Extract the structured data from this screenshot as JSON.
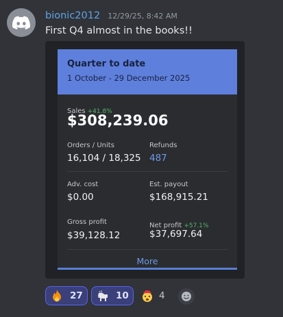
{
  "message": {
    "username": "bionic2012",
    "timestamp": "12/29/25, 8:42 AM",
    "text": "First Q4 almost in the books!!",
    "avatar_icon": "discord-logo-icon"
  },
  "embed": {
    "title": "Quarter to date",
    "date_range": "1 October - 29 December 2025",
    "sales": {
      "label": "Sales",
      "change": "+41.8%",
      "value": "$308,239.06"
    },
    "orders_units": {
      "label": "Orders / Units",
      "value": "16,104 / 18,325"
    },
    "refunds": {
      "label": "Refunds",
      "value": "487"
    },
    "adv_cost": {
      "label": "Adv. cost",
      "value": "$0.00"
    },
    "est_payout": {
      "label": "Est. payout",
      "value": "$168,915.21"
    },
    "gross_profit": {
      "label": "Gross profit",
      "value": "$39,128.12"
    },
    "net_profit": {
      "label": "Net profit",
      "change": "+57.1%",
      "value": "$37,697.64"
    },
    "more_label": "More",
    "accent_color": "#5f7fdc"
  },
  "reactions": [
    {
      "emoji": "fire-icon",
      "count": "27",
      "active": true
    },
    {
      "emoji": "goat-icon",
      "count": "10",
      "active": true
    },
    {
      "emoji": "exploding-head-icon",
      "count": "4",
      "active": false
    },
    {
      "emoji": "add-reaction-icon"
    }
  ]
}
